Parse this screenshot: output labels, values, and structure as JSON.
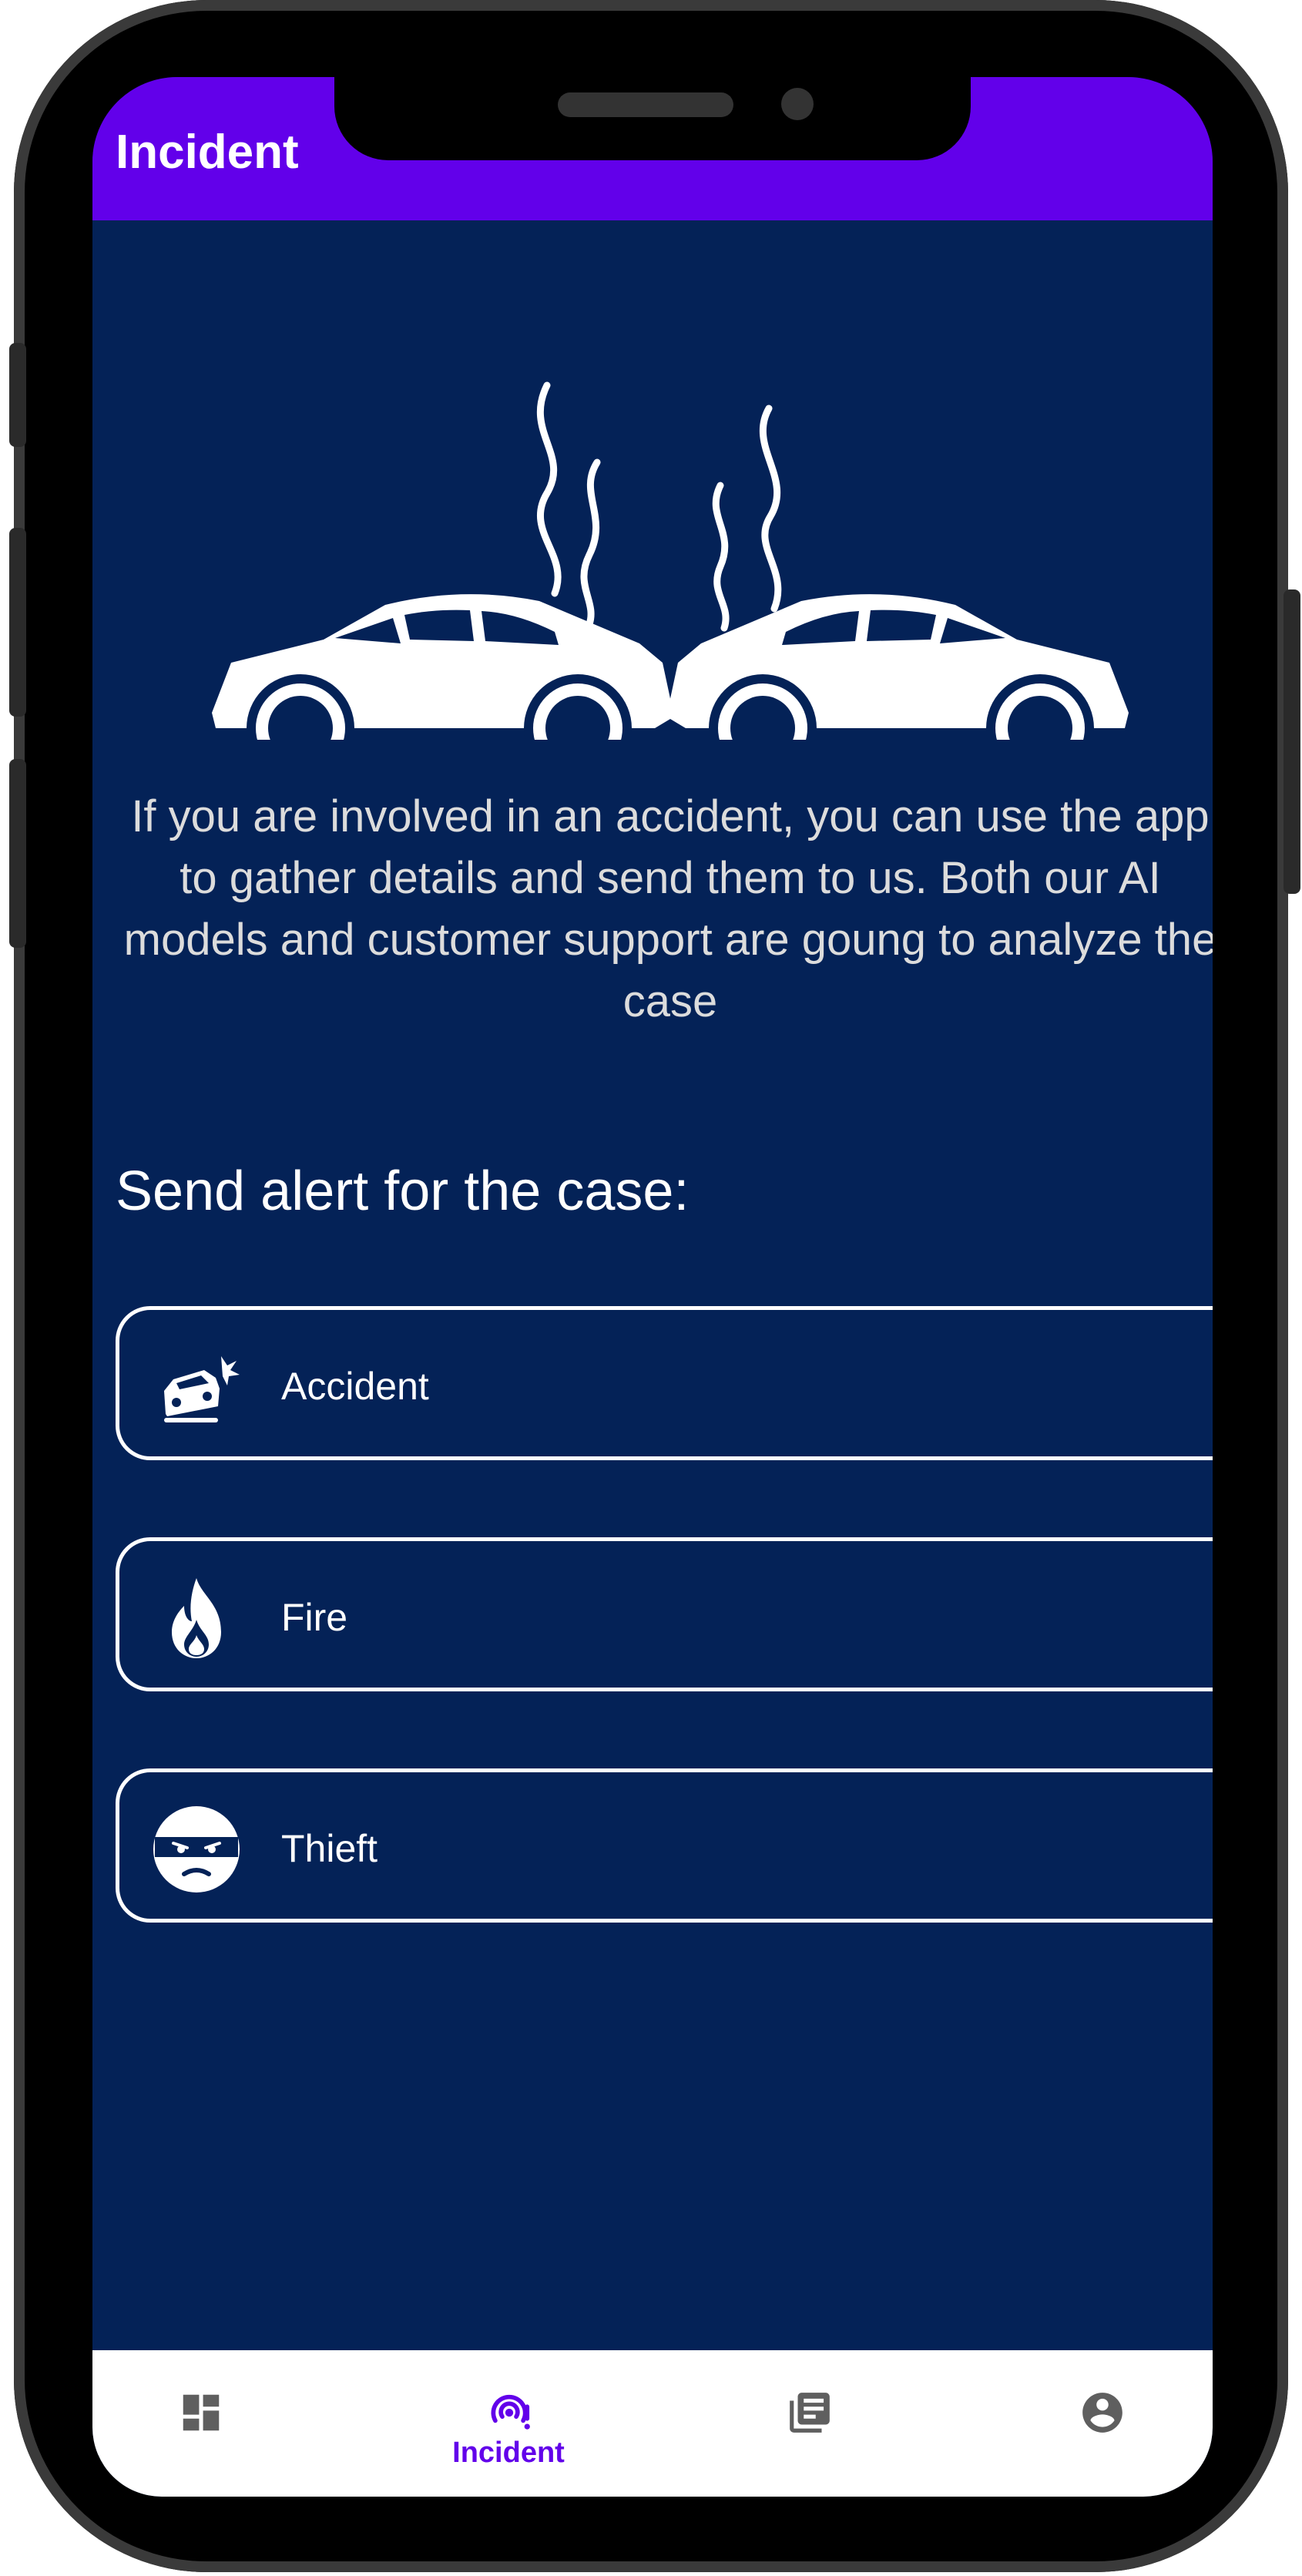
{
  "app_bar": {
    "title": "Incident"
  },
  "intro_text": "If you are involved in an accident, you can use the app to gather details and send them to us. Both our AI models and customer support are goung to analyze the case",
  "section_title": "Send alert for the case:",
  "options": [
    {
      "label": "Accident",
      "icon": "car-crash-icon"
    },
    {
      "label": "Fire",
      "icon": "fire-icon"
    },
    {
      "label": "Thieft",
      "icon": "thief-icon"
    }
  ],
  "bottom_nav": {
    "items": [
      {
        "icon": "dashboard-icon",
        "label": ""
      },
      {
        "icon": "incident-alert-icon",
        "label": "Incident"
      },
      {
        "icon": "library-books-icon",
        "label": ""
      },
      {
        "icon": "account-icon",
        "label": ""
      }
    ],
    "active_color": "#6200ea",
    "inactive_color": "#5f5f5f"
  },
  "colors": {
    "app_bar": "#6200ea",
    "background": "#042257",
    "text_light": "#dcdcdc"
  }
}
